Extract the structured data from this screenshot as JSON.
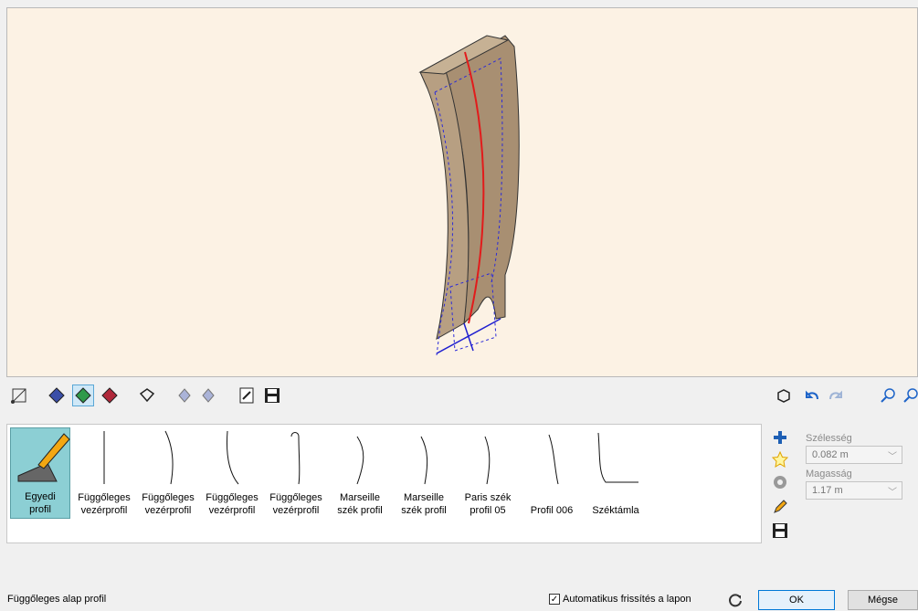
{
  "profiles": [
    {
      "line1": "Egyedi",
      "line2": "profil",
      "icon": "custom-profile-pencil-icon"
    },
    {
      "line1": "Függőleges",
      "line2": "vezérprofil",
      "icon": "straight-line-profile-icon"
    },
    {
      "line1": "Függőleges",
      "line2": "vezérprofil",
      "icon": "slight-curve-profile-icon"
    },
    {
      "line1": "Függőleges",
      "line2": "vezérprofil",
      "icon": "curve-profile-icon"
    },
    {
      "line1": "Függőleges",
      "line2": "vezérprofil",
      "icon": "hook-curve-profile-icon"
    },
    {
      "line1": "Marseille",
      "line2": "szék profil",
      "icon": "marseille-profile-icon"
    },
    {
      "line1": "Marseille",
      "line2": "szék profil",
      "icon": "marseille-profile-icon"
    },
    {
      "line1": "Paris szék",
      "line2": "profil 05",
      "icon": "paris-profile-icon"
    },
    {
      "line1": "",
      "line2": "Profil 006",
      "icon": "profile-006-icon"
    },
    {
      "line1": "",
      "line2": "Széktámla",
      "icon": "chair-back-profile-icon"
    }
  ],
  "fields": {
    "width_label": "Szélesség",
    "width_value": "0.082 m",
    "height_label": "Magasság",
    "height_value": "1.17 m"
  },
  "status_text": "Függőleges alap profil",
  "auto_refresh_label": "Automatikus frissítés a lapon",
  "auto_refresh_checked": "✓",
  "ok_label": "OK",
  "cancel_label": "Mégse",
  "colors": {
    "viewport_bg": "#fcf2e4",
    "selected_tile": "#8ccfd4",
    "wood": "#b79f82",
    "accent_blue": "#0078d7"
  }
}
